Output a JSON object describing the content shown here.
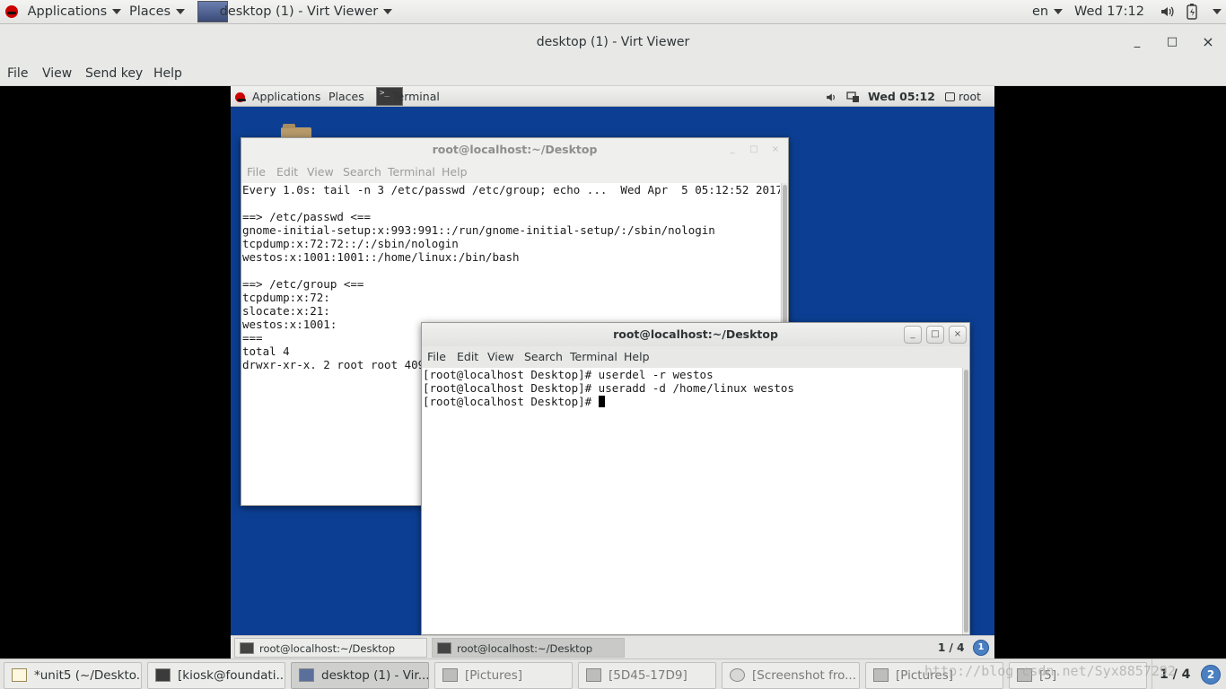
{
  "host_panel": {
    "applications": "Applications",
    "places": "Places",
    "window_title": "desktop (1) - Virt Viewer",
    "language": "en",
    "clock": "Wed 17:12"
  },
  "virt_viewer": {
    "title": "desktop (1) - Virt Viewer",
    "minimize": "_",
    "maximize": "□",
    "close": "×",
    "menu": [
      "File",
      "View",
      "Send key",
      "Help"
    ]
  },
  "guest_panel": {
    "applications": "Applications",
    "places": "Places",
    "active_app": "Terminal",
    "clock": "Wed 05:12",
    "user": "root"
  },
  "terminal_back": {
    "title": "root@localhost:~/Desktop",
    "menu": [
      "File",
      "Edit",
      "View",
      "Search",
      "Terminal",
      "Help"
    ],
    "lines": [
      "Every 1.0s: tail -n 3 /etc/passwd /etc/group; echo ...  Wed Apr  5 05:12:52 2017",
      "",
      "==> /etc/passwd <==",
      "gnome-initial-setup:x:993:991::/run/gnome-initial-setup/:/sbin/nologin",
      "tcpdump:x:72:72::/:/sbin/nologin",
      "westos:x:1001:1001::/home/linux:/bin/bash",
      "",
      "==> /etc/group <==",
      "tcpdump:x:72:",
      "slocate:x:21:",
      "westos:x:1001:",
      "===",
      "total 4",
      "drwxr-xr-x. 2 root root 409"
    ]
  },
  "terminal_front": {
    "title": "root@localhost:~/Desktop",
    "menu": [
      "File",
      "Edit",
      "View",
      "Search",
      "Terminal",
      "Help"
    ],
    "lines": [
      "[root@localhost Desktop]# userdel -r westos",
      "[root@localhost Desktop]# useradd -d /home/linux westos",
      "[root@localhost Desktop]# "
    ]
  },
  "guest_taskbar": {
    "tasks": [
      "root@localhost:~/Desktop",
      "root@localhost:~/Desktop"
    ],
    "pager": "1 / 4",
    "badge": "1"
  },
  "host_taskbar": {
    "tasks": [
      "*unit5 (~/Deskto...",
      "[kiosk@foundati...",
      "desktop (1) - Vir...",
      "[Pictures]",
      "[5D45-17D9]",
      "[Screenshot fro...",
      "[Pictures]",
      "[5]"
    ],
    "pager": "1 / 4",
    "badge": "2",
    "watermark": "http://blog.csdn.net/Syx8857292"
  }
}
